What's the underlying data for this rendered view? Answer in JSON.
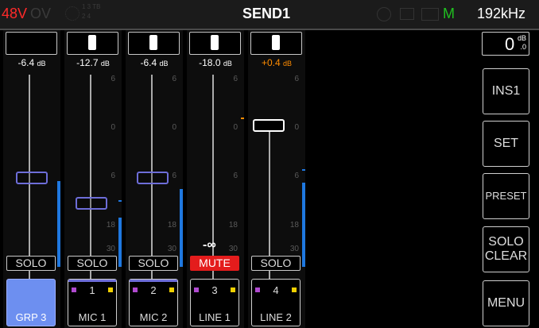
{
  "topbar": {
    "phantom": "48V",
    "ov": "OV",
    "route_top": "1 3 TB",
    "route_bot": "2 4",
    "title": "SEND1",
    "m_label": "M",
    "sample_rate": "192kHz",
    "accent_red": "#ff2a2a",
    "accent_green": "#20c020"
  },
  "strips": [
    {
      "level_value": "-6.4",
      "level_unit": "dB",
      "button": "SOLO",
      "button_type": "solo",
      "channel_num": "",
      "channel_name": "GRP 3",
      "selected": true,
      "fader_db": -6.4
    },
    {
      "level_value": "-12.7",
      "level_unit": "dB",
      "button": "SOLO",
      "button_type": "solo",
      "channel_num": "1",
      "channel_name": "MIC 1",
      "selected": false,
      "fader_db": -12.7
    },
    {
      "level_value": "-6.4",
      "level_unit": "dB",
      "button": "SOLO",
      "button_type": "solo",
      "channel_num": "2",
      "channel_name": "MIC 2",
      "selected": false,
      "fader_db": -6.4
    },
    {
      "level_value": "-18.0",
      "level_unit": "dB",
      "button": "MUTE",
      "button_type": "mute",
      "channel_num": "3",
      "channel_name": "LINE 1",
      "selected": false,
      "fader_db": -99,
      "fader_label": "-∞"
    },
    {
      "level_value": "+0.4",
      "level_unit": "dB",
      "button": "SOLO",
      "button_type": "solo",
      "channel_num": "4",
      "channel_name": "LINE 2",
      "selected": false,
      "fader_db": 0.4,
      "level_color": "#ff8c00"
    }
  ],
  "scale_labels": [
    "6",
    "0",
    "6",
    "18",
    "30"
  ],
  "right": {
    "gain_value": "0",
    "gain_unit": "dB",
    "gain_decimal": ".0",
    "ins": "INS1",
    "set": "SET",
    "preset": "PRESET",
    "solo_clear_1": "SOLO",
    "solo_clear_2": "CLEAR",
    "menu": "MENU"
  }
}
